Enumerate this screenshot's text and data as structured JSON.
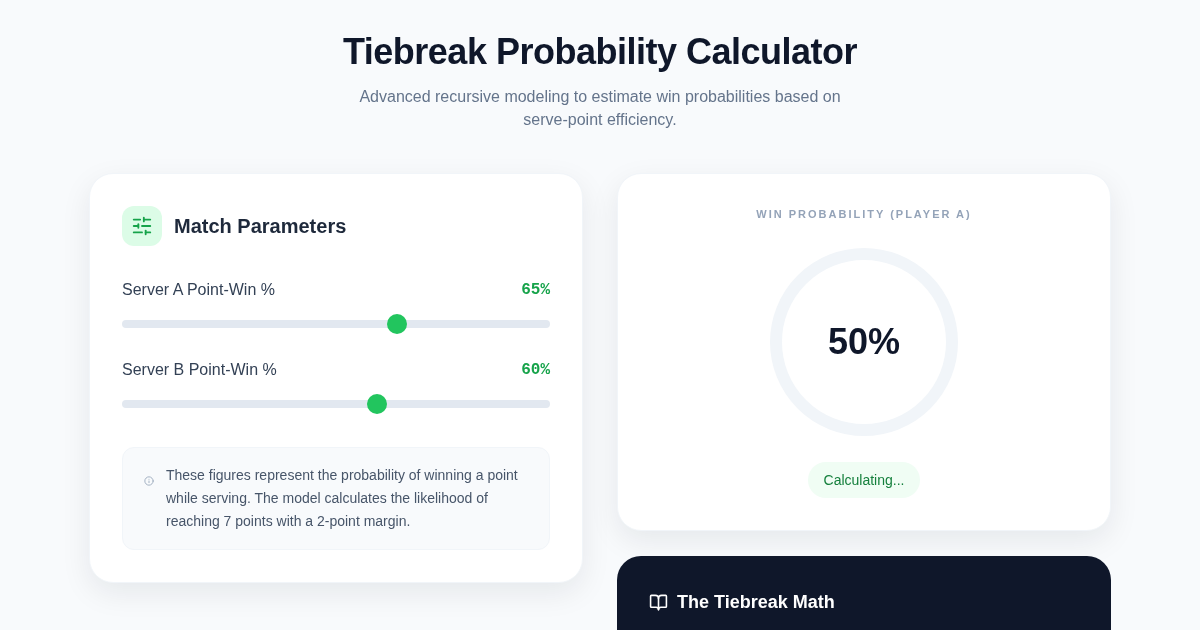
{
  "header": {
    "title": "Tiebreak Probability Calculator",
    "subtitle": "Advanced recursive modeling to estimate win probabilities based on serve-point efficiency."
  },
  "parameters_card": {
    "title": "Match Parameters",
    "sliders": [
      {
        "label": "Server A Point-Win %",
        "reading": "65%",
        "level": 0.65
      },
      {
        "label": "Server B Point-Win %",
        "reading": "60%",
        "level": 0.6
      }
    ],
    "note": "These figures represent the probability of winning a point while serving. The model calculates the likelihood of reaching 7 points with a 2-point margin."
  },
  "result_card": {
    "label": "WIN PROBABILITY (PLAYER A)",
    "value": "50%",
    "status": "Calculating..."
  },
  "math_card": {
    "title": "The Tiebreak Math"
  }
}
